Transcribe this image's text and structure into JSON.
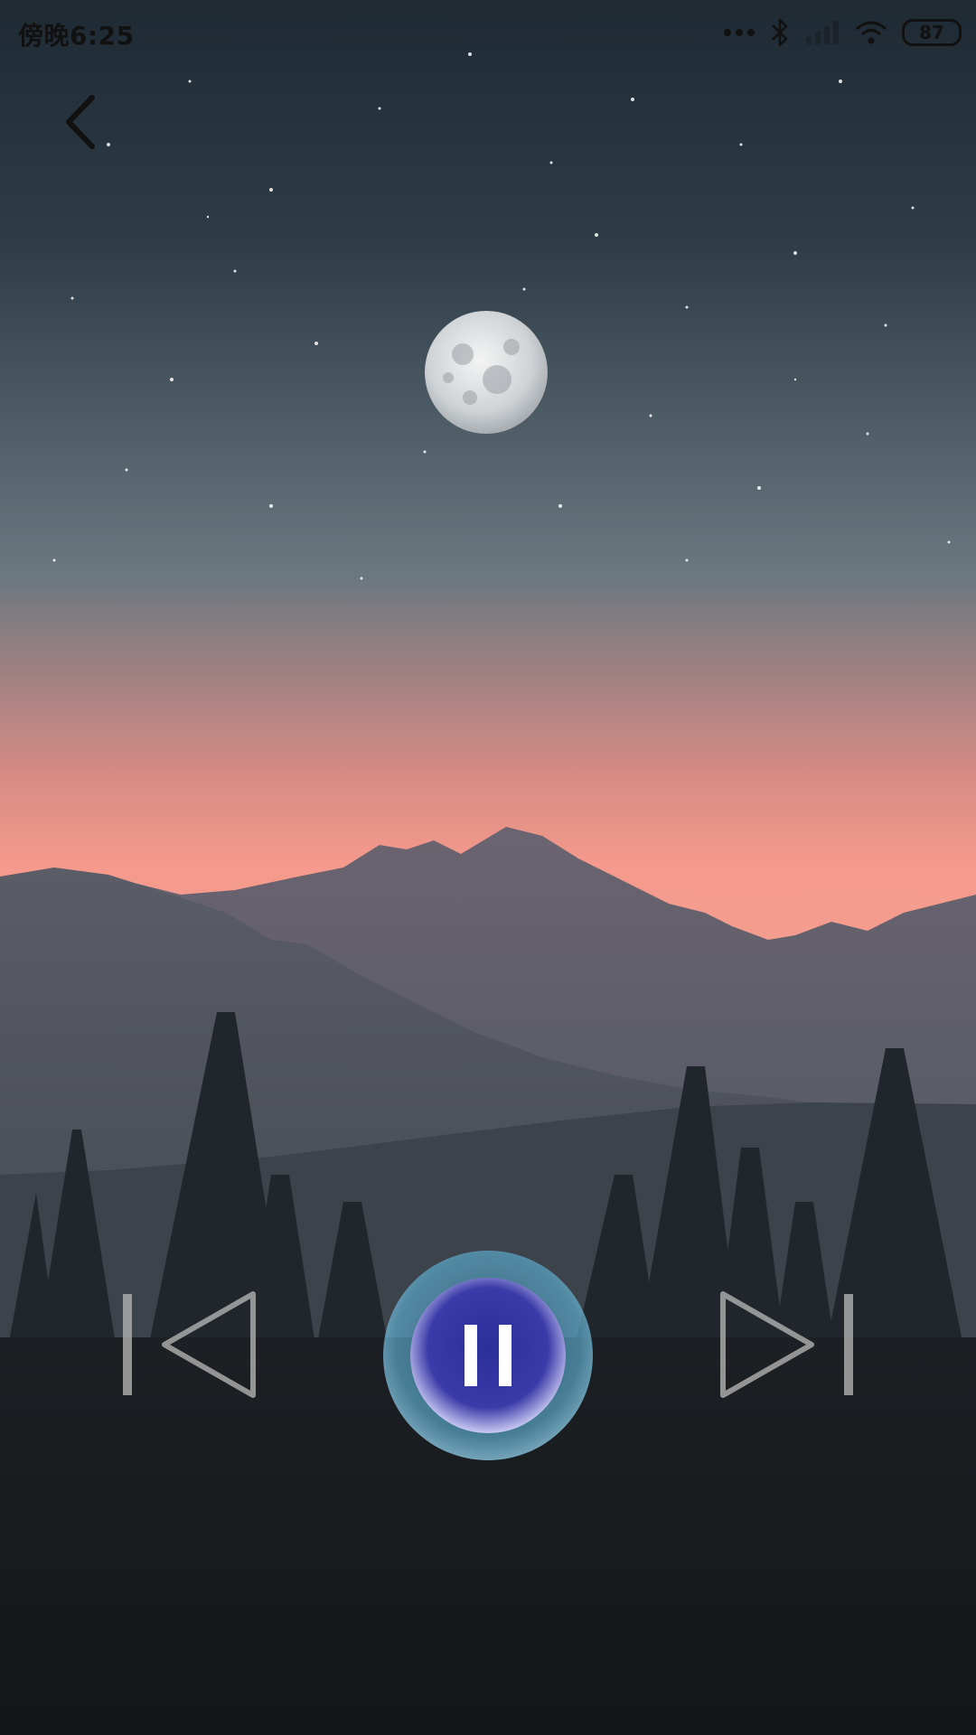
{
  "status_bar": {
    "time": "傍晚6:25",
    "battery": "87",
    "icons": [
      "more-dots-icon",
      "bluetooth-icon",
      "signal-icon",
      "wifi-icon",
      "battery-icon"
    ]
  },
  "navigation": {
    "back_icon": "chevron-left-icon"
  },
  "player": {
    "state": "playing",
    "prev_icon": "skip-previous-icon",
    "play_pause_icon": "pause-icon",
    "next_icon": "skip-next-icon"
  },
  "colors": {
    "sky_top": "#1f2a33",
    "horizon_glow": "#f59a8c",
    "pause_button": "#3a3aa8",
    "ring": "#5aa7c8"
  }
}
